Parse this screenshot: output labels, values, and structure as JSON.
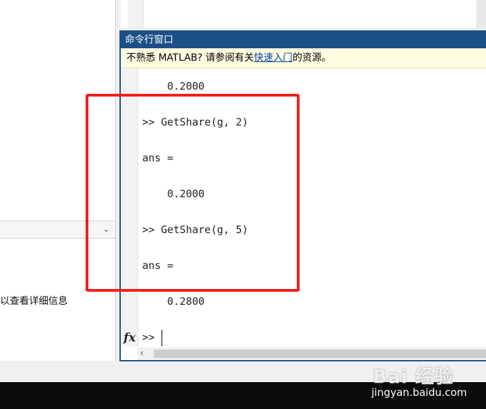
{
  "left_panel": {
    "info_text": "以查看详细信息"
  },
  "command_window": {
    "title": "命令行窗口",
    "notice": {
      "prefix": "不熟悉 MATLAB? 请参阅有关",
      "link": "快速入门",
      "suffix": "的资源。"
    },
    "lines": [
      "    0.2000",
      ">> GetShare(g, 2)",
      "ans =",
      "    0.2000",
      ">> GetShare(g, 5)",
      "ans =",
      "    0.2800"
    ],
    "prompt": ">>",
    "fx_icon": "fx"
  },
  "watermark": {
    "logo": "Bai 经验",
    "url": "jingyan.baidu.com"
  },
  "colors": {
    "title_bar": "#1c4f86",
    "highlight": "#f0201a",
    "notice_bg": "#fffde0"
  }
}
